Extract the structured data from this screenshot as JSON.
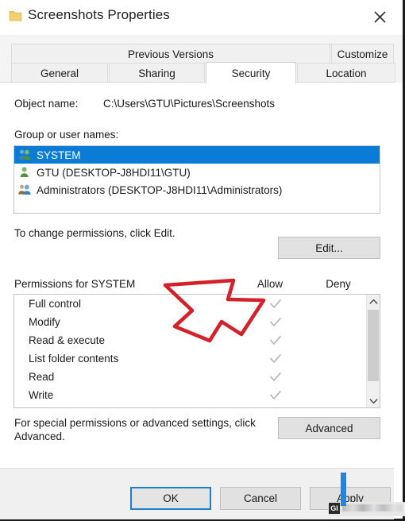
{
  "window": {
    "title": "Screenshots Properties",
    "icon": "folder-icon",
    "close_label": "✕"
  },
  "tabs": {
    "top_row": [
      {
        "label": "Previous Versions",
        "selected": false
      },
      {
        "label": "Customize",
        "selected": false
      }
    ],
    "bottom_row": [
      {
        "label": "General",
        "selected": false
      },
      {
        "label": "Sharing",
        "selected": false
      },
      {
        "label": "Security",
        "selected": true
      },
      {
        "label": "Location",
        "selected": false
      }
    ]
  },
  "security": {
    "object_name_label": "Object name:",
    "object_name_value": "C:\\Users\\GTU\\Pictures\\Screenshots",
    "group_names_label": "Group or user names:",
    "groups": [
      {
        "label": "SYSTEM",
        "icon": "group-icon",
        "selected": true
      },
      {
        "label": "GTU (DESKTOP-J8HDI11\\GTU)",
        "icon": "user-icon",
        "selected": false
      },
      {
        "label": "Administrators (DESKTOP-J8HDI11\\Administrators)",
        "icon": "group-icon",
        "selected": false
      }
    ],
    "edit_hint": "To change permissions, click Edit.",
    "edit_button": "Edit...",
    "permissions_title": "Permissions for SYSTEM",
    "allow_header": "Allow",
    "deny_header": "Deny",
    "permissions": [
      {
        "name": "Full control",
        "allow": true,
        "deny": false
      },
      {
        "name": "Modify",
        "allow": true,
        "deny": false
      },
      {
        "name": "Read & execute",
        "allow": true,
        "deny": false
      },
      {
        "name": "List folder contents",
        "allow": true,
        "deny": false
      },
      {
        "name": "Read",
        "allow": true,
        "deny": false
      },
      {
        "name": "Write",
        "allow": true,
        "deny": false
      }
    ],
    "advanced_hint": "For special permissions or advanced settings, click Advanced.",
    "advanced_button": "Advanced"
  },
  "footer": {
    "ok_label": "OK",
    "cancel_label": "Cancel",
    "apply_label": "Apply"
  },
  "annotation": {
    "arrow_color": "#d42028",
    "arrow_description": "hand-drawn red arrow pointing to Edit button"
  },
  "overlay": {
    "mark_text": "GI",
    "caret_color": "#1f86e0"
  },
  "colors": {
    "selection_blue": "#0a7cd6",
    "focus_blue": "#1e7fd0",
    "accent_red": "#d42028",
    "checkmark_gray": "#b6b6b6",
    "tab_bar": "#f4f4f4",
    "button_face": "#e1e1e1"
  }
}
